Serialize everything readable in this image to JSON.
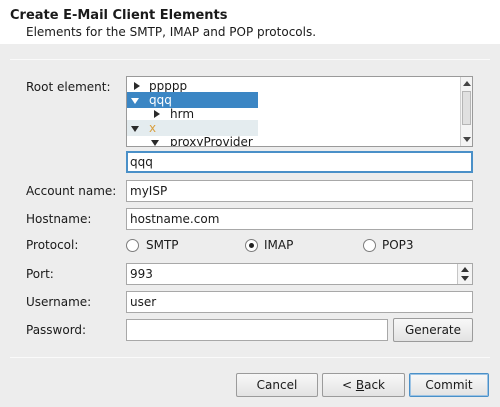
{
  "header": {
    "title": "Create E-Mail Client Elements",
    "subtitle": "Elements for the SMTP, IMAP and POP protocols."
  },
  "root_element": {
    "label": "Root element:",
    "tree": [
      {
        "label": "ppppp",
        "expanded": false,
        "selected": false
      },
      {
        "label": "qqq",
        "expanded": true,
        "selected": true
      },
      {
        "label": "hrm",
        "expanded": false,
        "selected": false
      },
      {
        "label": "x",
        "expanded": true,
        "selected": false,
        "icon": "warning-x-icon"
      },
      {
        "label": "proxyProvider",
        "expanded": true,
        "selected": false
      }
    ],
    "selected_value": "qqq"
  },
  "account_name": {
    "label": "Account name:",
    "value": "myISP"
  },
  "hostname": {
    "label": "Hostname:",
    "value": "hostname.com"
  },
  "protocol": {
    "label": "Protocol:",
    "options": [
      "SMTP",
      "IMAP",
      "POP3"
    ],
    "selected": "IMAP"
  },
  "port": {
    "label": "Port:",
    "value": "993"
  },
  "username": {
    "label": "Username:",
    "value": "user"
  },
  "password": {
    "label": "Password:",
    "value": "",
    "generate_label": "Generate"
  },
  "buttons": {
    "cancel": "Cancel",
    "back_prefix": "< ",
    "back_mnemonic": "B",
    "back_rest": "ack",
    "commit": "Commit"
  },
  "colors": {
    "selection": "#3b86c4",
    "focus": "#4a90c8",
    "warning_x": "#d9a040"
  }
}
